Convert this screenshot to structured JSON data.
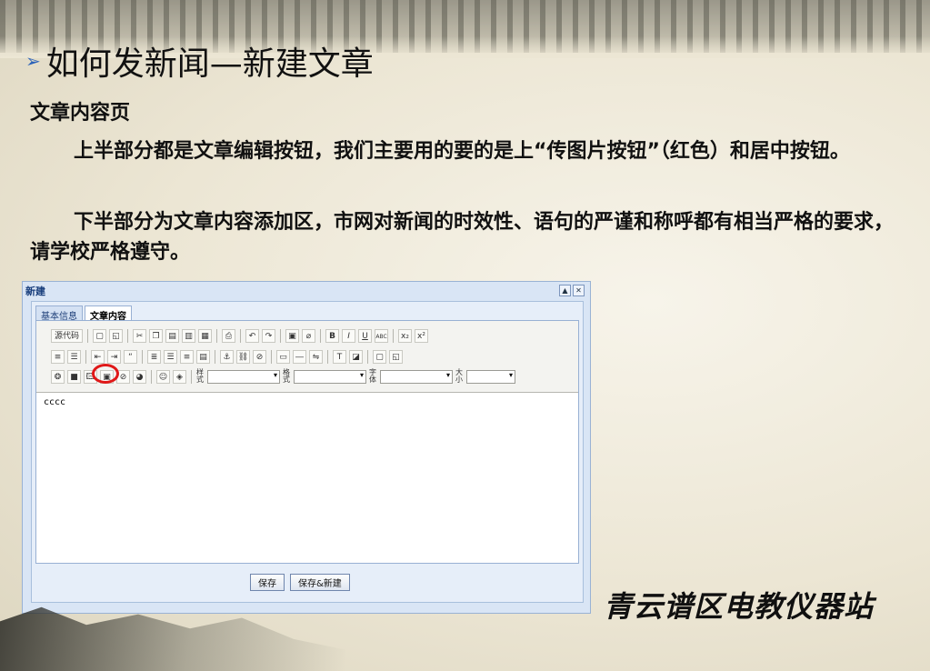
{
  "slide": {
    "title": "如何发新闻—新建文章",
    "bullet": "➢",
    "subhead": "文章内容页",
    "para1": "上半部分都是文章编辑按钮，我们主要用的要的是上“传图片按钮”（红色）和居中按钮。",
    "para2": "下半部分为文章内容添加区，市网对新闻的时效性、语句的严谨和称呼都有相当严格的要求，请学校严格遵守。",
    "station": "青云谱区电教仪器站"
  },
  "dialog": {
    "title": "新建",
    "title_buttons": [
      "▲",
      "✕"
    ],
    "tabs": [
      {
        "label": "基本信息",
        "active": false
      },
      {
        "label": "文章内容",
        "active": true
      }
    ],
    "toolbar": {
      "source_label": "源代码",
      "bold": "B",
      "italic": "I",
      "underline": "U",
      "strike": "ABC",
      "style_label": "样式",
      "format_label": "格式",
      "font_label": "字体",
      "size_label": "大小"
    },
    "content_text": "cccc",
    "save_label": "保存",
    "save_new_label": "保存&新建"
  },
  "colors": {
    "highlight": "#e01818",
    "dialog_bg": "#d9e5f5"
  }
}
